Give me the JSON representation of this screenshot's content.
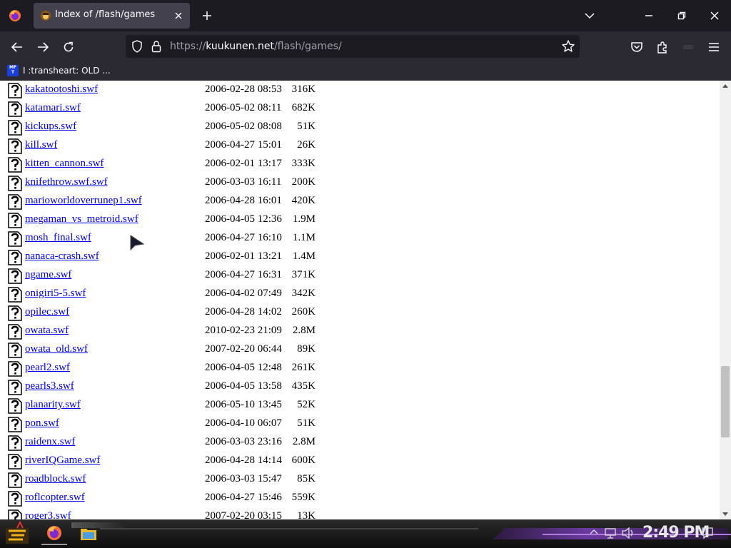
{
  "browser": {
    "tab": {
      "title": "Index of /flash/games"
    },
    "url": {
      "prefix": "https://",
      "host": "kuukunen.net",
      "path": "/flash/games/"
    },
    "bookmarks": [
      {
        "label": "I :transheart: OLD ..."
      }
    ]
  },
  "listing": [
    {
      "name": "kakatootoshi.swf",
      "date": "2006-02-28 08:53",
      "size": "316K"
    },
    {
      "name": "katamari.swf",
      "date": "2006-05-02 08:11",
      "size": "682K"
    },
    {
      "name": "kickups.swf",
      "date": "2006-05-02 08:08",
      "size": "51K"
    },
    {
      "name": "kill.swf",
      "date": "2006-04-27 15:01",
      "size": "26K"
    },
    {
      "name": "kitten_cannon.swf",
      "date": "2006-02-01 13:17",
      "size": "333K"
    },
    {
      "name": "knifethrow.swf.swf",
      "date": "2006-03-03 16:11",
      "size": "200K"
    },
    {
      "name": "marioworldoverrunep1.swf",
      "date": "2006-04-28 16:01",
      "size": "420K"
    },
    {
      "name": "megaman_vs_metroid.swf",
      "date": "2006-04-05 12:36",
      "size": "1.9M"
    },
    {
      "name": "mosh_final.swf",
      "date": "2006-04-27 16:10",
      "size": "1.1M"
    },
    {
      "name": "nanaca-crash.swf",
      "date": "2006-02-01 13:21",
      "size": "1.4M"
    },
    {
      "name": "ngame.swf",
      "date": "2006-04-27 16:31",
      "size": "371K"
    },
    {
      "name": "onigiri5-5.swf",
      "date": "2006-04-02 07:49",
      "size": "342K"
    },
    {
      "name": "opilec.swf",
      "date": "2006-04-28 14:02",
      "size": "260K"
    },
    {
      "name": "owata.swf",
      "date": "2010-02-23 21:09",
      "size": "2.8M"
    },
    {
      "name": "owata_old.swf",
      "date": "2007-02-20 06:44",
      "size": "89K"
    },
    {
      "name": "pearl2.swf",
      "date": "2006-04-05 12:48",
      "size": "261K"
    },
    {
      "name": "pearls3.swf",
      "date": "2006-04-05 13:58",
      "size": "435K"
    },
    {
      "name": "planarity.swf",
      "date": "2006-05-10 13:45",
      "size": "52K"
    },
    {
      "name": "pon.swf",
      "date": "2006-04-10 06:07",
      "size": "51K"
    },
    {
      "name": "raidenx.swf",
      "date": "2006-03-03 23:16",
      "size": "2.8M"
    },
    {
      "name": "riverIQGame.swf",
      "date": "2006-04-28 14:14",
      "size": "600K"
    },
    {
      "name": "roadblock.swf",
      "date": "2006-03-03 15:47",
      "size": "85K"
    },
    {
      "name": "roflcopter.swf",
      "date": "2006-04-27 15:46",
      "size": "559K"
    },
    {
      "name": "roger3.swf",
      "date": "2007-02-20 03:15",
      "size": "13K"
    }
  ],
  "taskbar": {
    "clock": "2:49 PM"
  }
}
